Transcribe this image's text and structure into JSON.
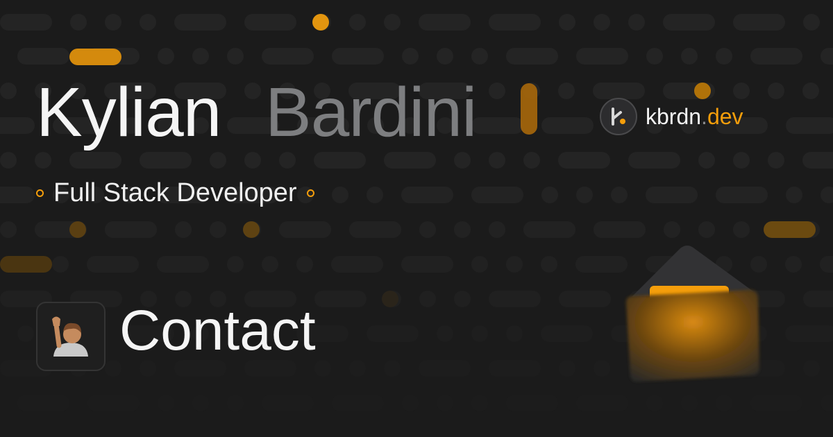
{
  "header": {
    "first_name": "Kylian",
    "last_name": "Bardini",
    "role": "Full Stack Developer"
  },
  "brand": {
    "name": "kbrdn",
    "dot": ".",
    "tld": "dev"
  },
  "page": {
    "title": "Contact",
    "emoji_icon": "raising-hand-icon"
  },
  "decorations": {
    "envelope_icon": "envelope-icon",
    "role_bullet_icon": "ring-bullet-icon",
    "logo_icon": "kbrdn-logo-icon"
  },
  "colors": {
    "background": "#1b1b1b",
    "pattern": "#242424",
    "accent": "#f59e0b",
    "text_primary": "#f5f5f5",
    "text_muted": "#7d7e80"
  }
}
